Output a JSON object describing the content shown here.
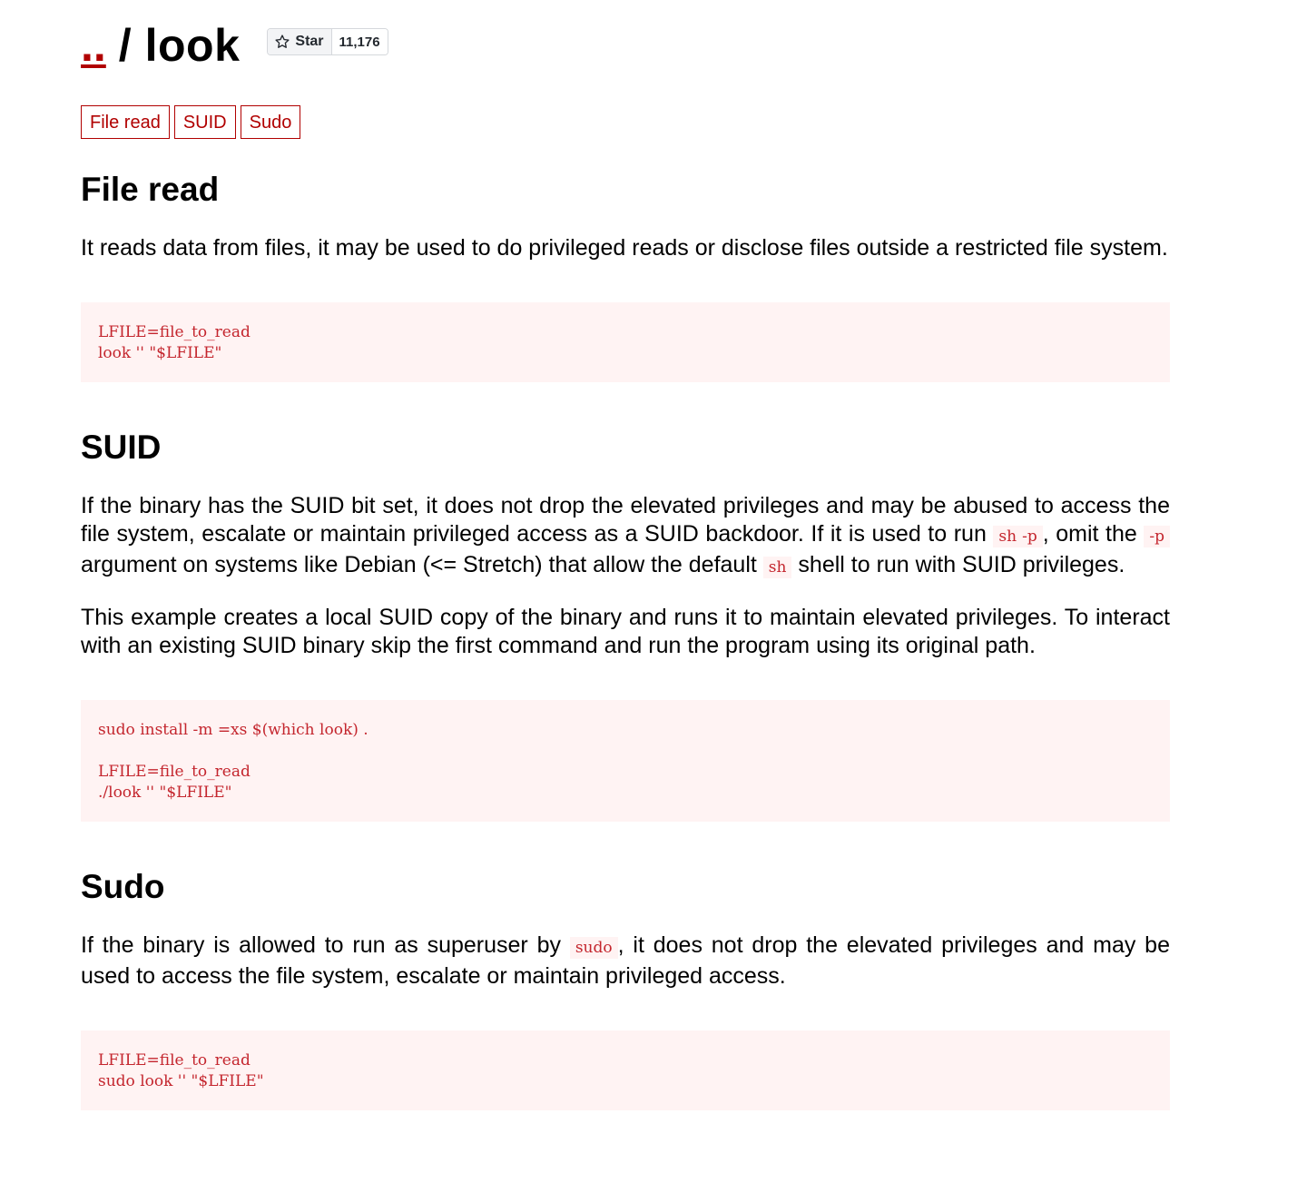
{
  "header": {
    "up_link": "..",
    "separator": "/",
    "title": "look",
    "star": {
      "label": "Star",
      "count": "11,176",
      "icon": "star-outline-icon"
    }
  },
  "tags": [
    {
      "label": "File read"
    },
    {
      "label": "SUID"
    },
    {
      "label": "Sudo"
    }
  ],
  "sections": {
    "file_read": {
      "title": "File read",
      "paragraph": "It reads data from files, it may be used to do privileged reads or disclose files outside a restricted file system.",
      "code": [
        "LFILE=file_to_read",
        "look '' \"$LFILE\""
      ]
    },
    "suid": {
      "title": "SUID",
      "p1": {
        "text_a": "If the binary has the SUID bit set, it does not drop the elevated privileges and may be abused to access the file system, escalate or maintain privileged access as a SUID backdoor. If it is used to run ",
        "code_a": "sh -p",
        "text_b": ", omit the ",
        "code_b": "-p",
        "text_c": " argument on systems like Debian (<= Stretch) that allow the default ",
        "code_c": "sh",
        "text_d": " shell to run with SUID privileges."
      },
      "p2": "This example creates a local SUID copy of the binary and runs it to maintain elevated privileges. To interact with an existing SUID binary skip the first command and run the program using its original path.",
      "code": [
        "sudo install -m =xs $(which look) .",
        "",
        "LFILE=file_to_read",
        "./look '' \"$LFILE\""
      ]
    },
    "sudo": {
      "title": "Sudo",
      "p1": {
        "text_a": "If the binary is allowed to run as superuser by ",
        "code_a": "sudo",
        "text_b": ", it does not drop the elevated privileges and may be used to access the file system, escalate or maintain privileged access."
      },
      "code": [
        "LFILE=file_to_read",
        "sudo look '' \"$LFILE\""
      ]
    }
  },
  "colors": {
    "accent": "#b10000",
    "code_text": "#c4262e",
    "code_bg": "#fff3f3"
  }
}
